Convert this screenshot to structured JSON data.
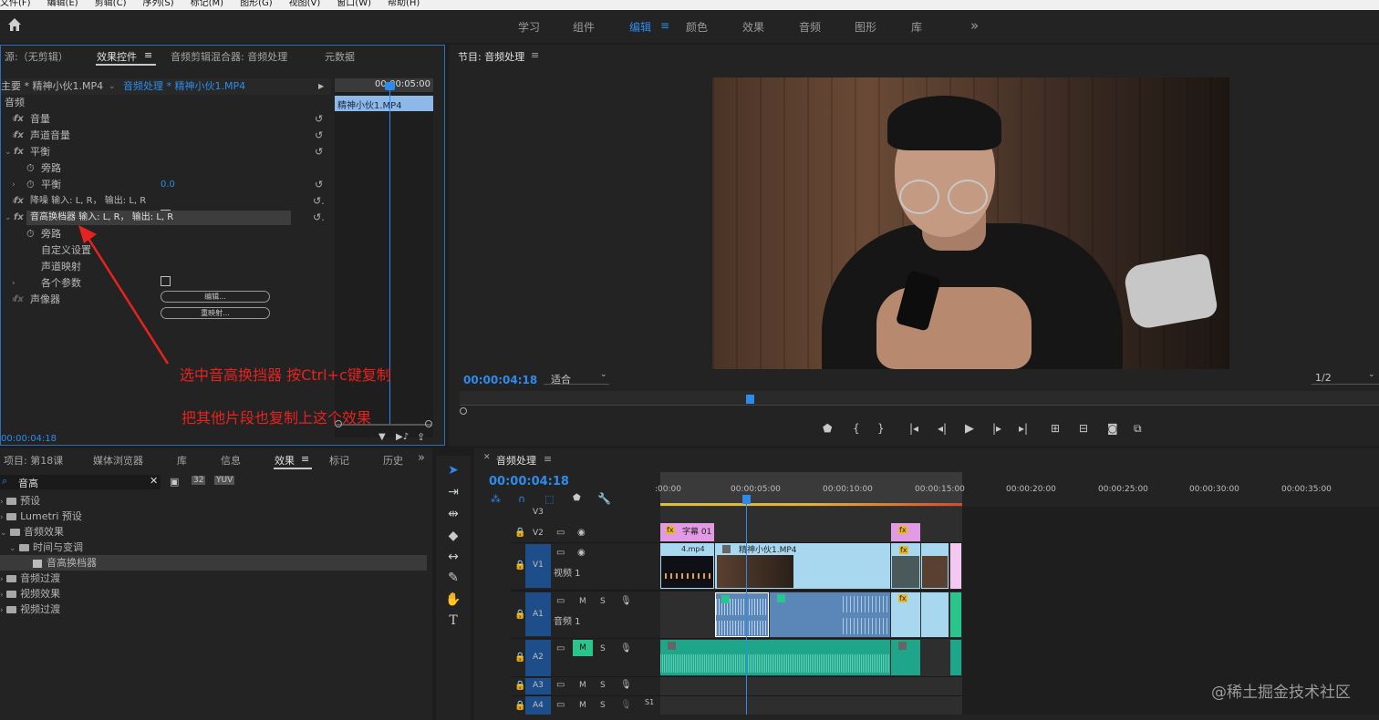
{
  "menu": [
    "文件(F)",
    "编辑(E)",
    "剪辑(C)",
    "序列(S)",
    "标记(M)",
    "图形(G)",
    "视图(V)",
    "窗口(W)",
    "帮助(H)"
  ],
  "workspaces": [
    "学习",
    "组件",
    "编辑",
    "颜色",
    "效果",
    "音频",
    "图形",
    "库"
  ],
  "workspace_more": "»",
  "effects_panel": {
    "tabs": [
      "源:（无剪辑）",
      "效果控件",
      "音频剪辑混合器: 音频处理",
      "元数据"
    ],
    "master": "主要 * 精神小伙1.MP4",
    "sequence_clip": "音频处理 * 精神小伙1.MP4",
    "mini_timecode": "00:00:05:00",
    "mini_clip": "精神小伙1.MP4",
    "section": "音频",
    "rows": {
      "volume": "音量",
      "channel_volume": "声道音量",
      "balance": "平衡",
      "bypass1": "旁路",
      "balance_sub": "平衡",
      "balance_value": "0.0",
      "denoise": "降噪 输入: L, R， 输出: L, R",
      "pitch": "音高换档器 输入: L, R， 输出: L, R",
      "bypass2": "旁路",
      "custom": "自定义设置",
      "channel_map": "声道映射",
      "params": "各个参数",
      "panner": "声像器"
    },
    "edit_btn": "编辑...",
    "remap_btn": "重映射...",
    "timecode": "00:00:04:18"
  },
  "annotation": {
    "line1": "选中音高换挡器 按Ctrl+c键复制",
    "line2": "把其他片段也复制上这个效果"
  },
  "program": {
    "title": "节目: 音频处理",
    "timecode": "00:00:04:18",
    "fit": "适合",
    "ratio": "1/2"
  },
  "project_panel": {
    "tabs": [
      "项目: 第18课",
      "媒体浏览器",
      "库",
      "信息",
      "效果",
      "标记",
      "历史"
    ],
    "search": "音高",
    "tree": [
      "预设",
      "Lumetri 预设",
      "音频效果",
      "时间与变调",
      "音高换档器",
      "音频过渡",
      "视频效果",
      "视频过渡"
    ]
  },
  "timeline": {
    "title": "音频处理",
    "timecode": "00:00:04:18",
    "ruler": [
      ":00:00",
      "00:00:05:00",
      "00:00:10:00",
      "00:00:15:00",
      "00:00:20:00",
      "00:00:25:00",
      "00:00:30:00",
      "00:00:35:00"
    ],
    "tracks": {
      "v3": "V3",
      "v2": "V2",
      "v1": "V1",
      "v1_name": "视频 1",
      "a1": "A1",
      "a1_name": "音频 1",
      "a2": "A2",
      "a3": "A3",
      "a4": "A4",
      "m": "M",
      "s": "S",
      "s1": "S1"
    },
    "clips": {
      "subtitle": "字幕 01",
      "mp4": "4.mp4",
      "main": "精神小伙1.MP4"
    }
  },
  "watermark": "@稀土掘金技术社区",
  "colors": {
    "accent": "#2d8ceb",
    "annotation": "#e6231f",
    "audio_clip": "#5b87b8",
    "audio_clip2": "#1fa58a",
    "video_clip": "#a8d8f0",
    "subtitle_clip": "#e29ae4"
  }
}
